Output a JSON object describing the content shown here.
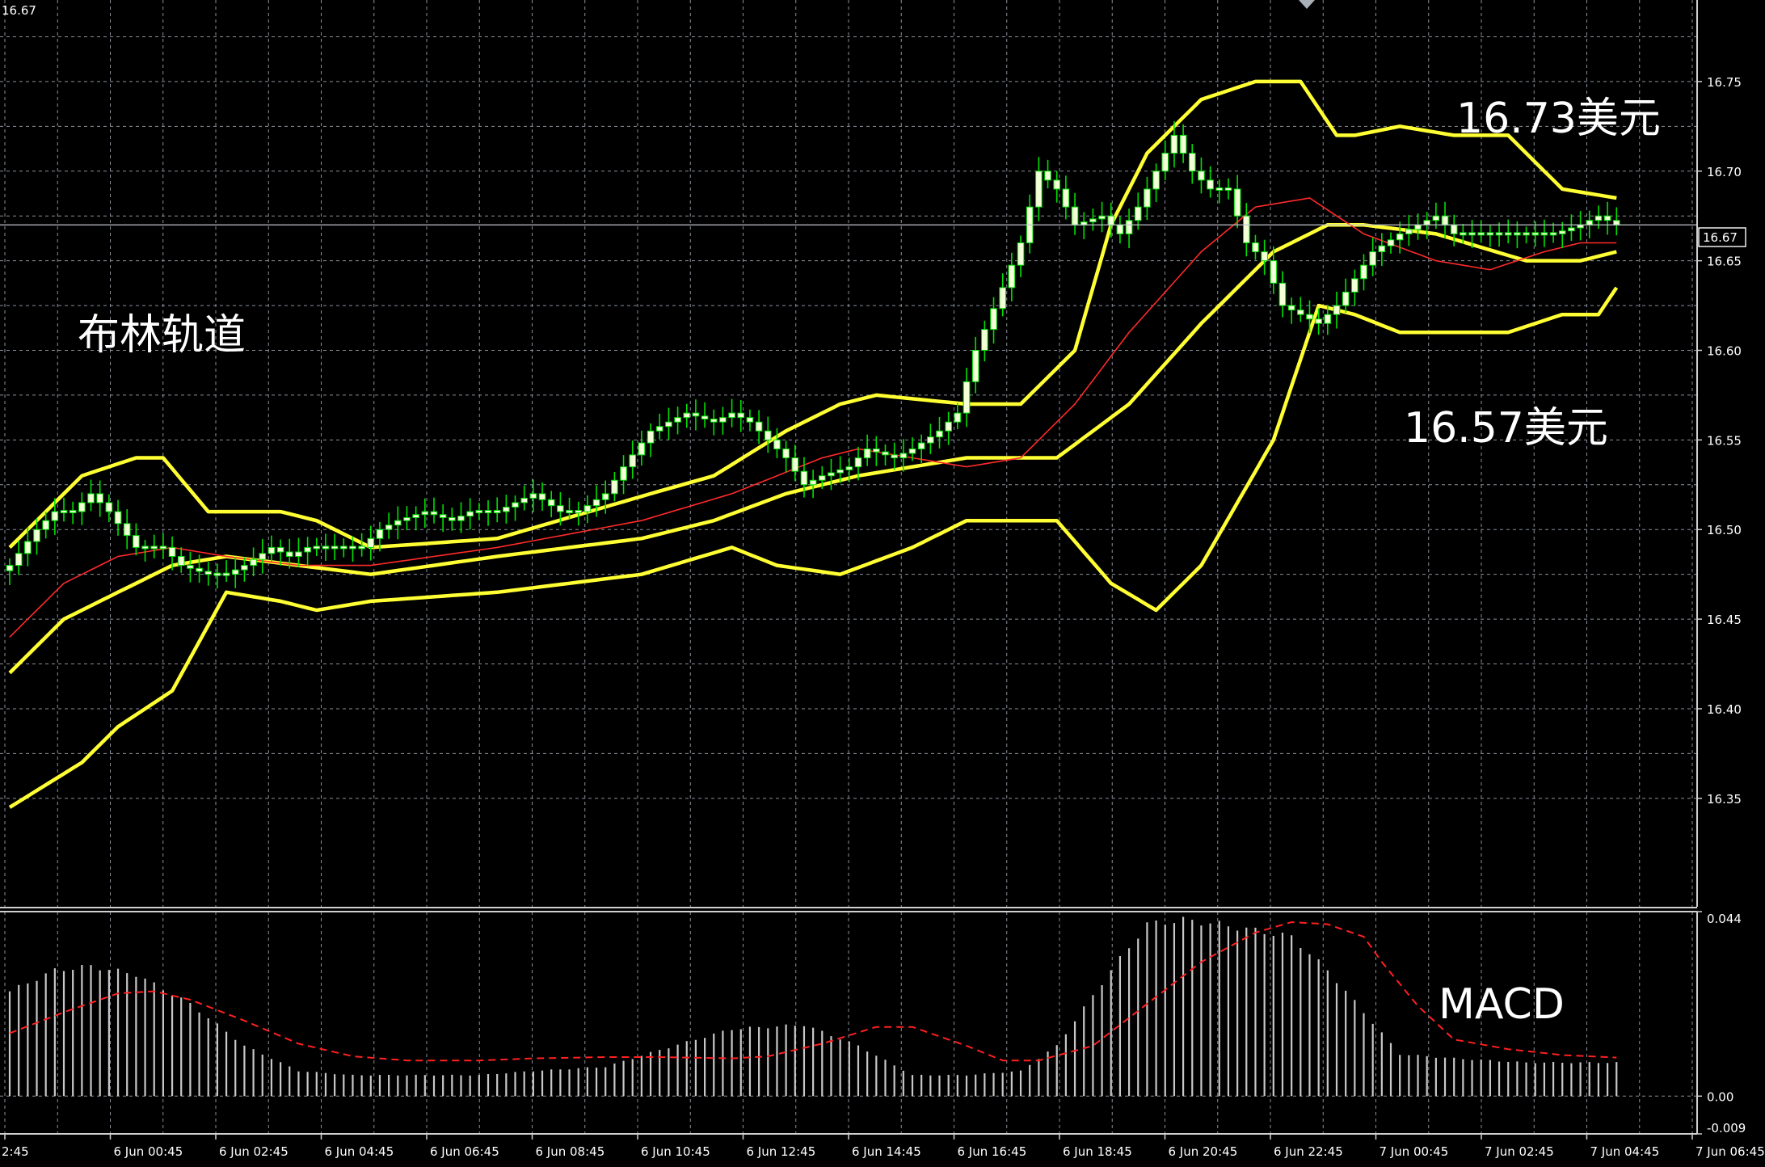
{
  "corner_price": "16.67",
  "current_price_label": "16.67",
  "annotations": {
    "bollinger": "布林轨道",
    "upper_price": "16.73美元",
    "lower_price": "16.57美元",
    "macd": "MACD"
  },
  "colors": {
    "background": "#000000",
    "grid": "#8a9099",
    "candle_body": "#f4ffd8",
    "candle_wick": "#00e000",
    "bollinger": "#ffff33",
    "ma_red": "#ff2a2a",
    "macd_histogram": "#c8c8c8",
    "macd_signal": "#ff2020",
    "text": "#ffffff"
  },
  "chart_data": [
    {
      "type": "candlestick",
      "indicator": "Bollinger Bands",
      "price_ticks": [
        "16.75",
        "16.70",
        "16.65",
        "16.60",
        "16.55",
        "16.50",
        "16.45",
        "16.40",
        "16.35"
      ],
      "ylim": [
        16.2895,
        16.7955
      ],
      "time_labels": [
        "2:45",
        "6 Jun 00:45",
        "6 Jun 02:45",
        "6 Jun 04:45",
        "6 Jun 06:45",
        "6 Jun 08:45",
        "6 Jun 10:45",
        "6 Jun 12:45",
        "6 Jun 14:45",
        "6 Jun 16:45",
        "6 Jun 18:45",
        "6 Jun 20:45",
        "6 Jun 22:45",
        "7 Jun 00:45",
        "7 Jun 02:45",
        "7 Jun 04:45",
        "7 Jun 06:45"
      ],
      "current_price": 16.67,
      "close_anchors": [
        [
          0,
          16.48
        ],
        [
          3,
          16.5
        ],
        [
          5,
          16.51
        ],
        [
          7,
          16.51
        ],
        [
          9,
          16.52
        ],
        [
          11,
          16.51
        ],
        [
          14,
          16.49
        ],
        [
          17,
          16.49
        ],
        [
          19,
          16.48
        ],
        [
          22,
          16.475
        ],
        [
          24,
          16.475
        ],
        [
          26,
          16.48
        ],
        [
          29,
          16.49
        ],
        [
          31,
          16.485
        ],
        [
          33,
          16.49
        ],
        [
          36,
          16.49
        ],
        [
          39,
          16.49
        ],
        [
          41,
          16.5
        ],
        [
          43,
          16.505
        ],
        [
          46,
          16.51
        ],
        [
          49,
          16.505
        ],
        [
          51,
          16.51
        ],
        [
          54,
          16.51
        ],
        [
          56,
          16.515
        ],
        [
          58,
          16.52
        ],
        [
          61,
          16.51
        ],
        [
          63,
          16.51
        ],
        [
          66,
          16.52
        ],
        [
          68,
          16.535
        ],
        [
          71,
          16.555
        ],
        [
          73,
          16.56
        ],
        [
          75,
          16.565
        ],
        [
          78,
          16.56
        ],
        [
          80,
          16.565
        ],
        [
          82,
          16.56
        ],
        [
          84,
          16.55
        ],
        [
          86,
          16.54
        ],
        [
          88,
          16.525
        ],
        [
          90,
          16.53
        ],
        [
          93,
          16.535
        ],
        [
          95,
          16.545
        ],
        [
          98,
          16.54
        ],
        [
          100,
          16.545
        ],
        [
          103,
          16.555
        ],
        [
          105,
          16.565
        ],
        [
          107,
          16.6
        ],
        [
          110,
          16.635
        ],
        [
          112,
          16.66
        ],
        [
          114,
          16.7
        ],
        [
          116,
          16.69
        ],
        [
          118,
          16.67
        ],
        [
          121,
          16.675
        ],
        [
          123,
          16.665
        ],
        [
          125,
          16.68
        ],
        [
          127,
          16.7
        ],
        [
          129,
          16.72
        ],
        [
          131,
          16.7
        ],
        [
          133,
          16.69
        ],
        [
          135,
          16.69
        ],
        [
          137,
          16.66
        ],
        [
          139,
          16.65
        ],
        [
          141,
          16.625
        ],
        [
          143,
          16.62
        ],
        [
          145,
          16.615
        ],
        [
          147,
          16.625
        ],
        [
          149,
          16.64
        ],
        [
          151,
          16.655
        ],
        [
          154,
          16.665
        ],
        [
          156,
          16.67
        ],
        [
          158,
          16.675
        ],
        [
          160,
          16.665
        ],
        [
          163,
          16.665
        ],
        [
          165,
          16.665
        ],
        [
          168,
          16.665
        ],
        [
          171,
          16.665
        ],
        [
          174,
          16.67
        ],
        [
          176,
          16.675
        ],
        [
          178,
          16.67
        ]
      ],
      "bollinger_upper": [
        [
          0,
          16.49
        ],
        [
          8,
          16.53
        ],
        [
          14,
          16.54
        ],
        [
          17,
          16.54
        ],
        [
          22,
          16.51
        ],
        [
          30,
          16.51
        ],
        [
          34,
          16.505
        ],
        [
          40,
          16.49
        ],
        [
          54,
          16.495
        ],
        [
          71,
          16.52
        ],
        [
          78,
          16.53
        ],
        [
          86,
          16.555
        ],
        [
          92,
          16.57
        ],
        [
          96,
          16.575
        ],
        [
          106,
          16.57
        ],
        [
          112,
          16.57
        ],
        [
          118,
          16.6
        ],
        [
          122,
          16.67
        ],
        [
          126,
          16.71
        ],
        [
          132,
          16.74
        ],
        [
          138,
          16.75
        ],
        [
          143,
          16.75
        ],
        [
          147,
          16.72
        ],
        [
          149,
          16.72
        ],
        [
          154,
          16.725
        ],
        [
          160,
          16.72
        ],
        [
          166,
          16.72
        ],
        [
          172,
          16.69
        ],
        [
          178,
          16.685
        ]
      ],
      "bollinger_middle": [
        [
          0,
          16.42
        ],
        [
          6,
          16.45
        ],
        [
          12,
          16.465
        ],
        [
          18,
          16.48
        ],
        [
          24,
          16.485
        ],
        [
          32,
          16.48
        ],
        [
          40,
          16.475
        ],
        [
          54,
          16.485
        ],
        [
          70,
          16.495
        ],
        [
          78,
          16.505
        ],
        [
          86,
          16.52
        ],
        [
          94,
          16.53
        ],
        [
          106,
          16.54
        ],
        [
          116,
          16.54
        ],
        [
          124,
          16.57
        ],
        [
          132,
          16.615
        ],
        [
          140,
          16.655
        ],
        [
          146,
          16.67
        ],
        [
          150,
          16.67
        ],
        [
          158,
          16.665
        ],
        [
          168,
          16.65
        ],
        [
          174,
          16.65
        ],
        [
          178,
          16.655
        ]
      ],
      "bollinger_lower": [
        [
          0,
          16.345
        ],
        [
          8,
          16.37
        ],
        [
          12,
          16.39
        ],
        [
          18,
          16.41
        ],
        [
          24,
          16.465
        ],
        [
          30,
          16.46
        ],
        [
          34,
          16.455
        ],
        [
          40,
          16.46
        ],
        [
          54,
          16.465
        ],
        [
          70,
          16.475
        ],
        [
          80,
          16.49
        ],
        [
          85,
          16.48
        ],
        [
          92,
          16.475
        ],
        [
          100,
          16.49
        ],
        [
          106,
          16.505
        ],
        [
          116,
          16.505
        ],
        [
          122,
          16.47
        ],
        [
          127,
          16.455
        ],
        [
          132,
          16.48
        ],
        [
          140,
          16.55
        ],
        [
          145,
          16.625
        ],
        [
          149,
          16.62
        ],
        [
          154,
          16.61
        ],
        [
          166,
          16.61
        ],
        [
          172,
          16.62
        ],
        [
          176,
          16.62
        ],
        [
          178,
          16.635
        ]
      ],
      "moving_average": [
        [
          0,
          16.44
        ],
        [
          6,
          16.47
        ],
        [
          12,
          16.485
        ],
        [
          18,
          16.49
        ],
        [
          24,
          16.485
        ],
        [
          32,
          16.48
        ],
        [
          40,
          16.48
        ],
        [
          54,
          16.49
        ],
        [
          70,
          16.505
        ],
        [
          80,
          16.52
        ],
        [
          90,
          16.54
        ],
        [
          94,
          16.545
        ],
        [
          106,
          16.535
        ],
        [
          112,
          16.54
        ],
        [
          118,
          16.57
        ],
        [
          124,
          16.61
        ],
        [
          132,
          16.655
        ],
        [
          138,
          16.68
        ],
        [
          144,
          16.685
        ],
        [
          150,
          16.665
        ],
        [
          158,
          16.65
        ],
        [
          164,
          16.645
        ],
        [
          170,
          16.655
        ],
        [
          174,
          16.66
        ],
        [
          178,
          16.66
        ]
      ]
    },
    {
      "type": "histogram",
      "indicator": "MACD",
      "value_ticks": [
        "0.044",
        "0.00",
        "-0.009"
      ],
      "ylim": [
        -0.009,
        0.044
      ],
      "histogram_anchors": [
        [
          0,
          0.025
        ],
        [
          5,
          0.03
        ],
        [
          9,
          0.031
        ],
        [
          14,
          0.029
        ],
        [
          20,
          0.022
        ],
        [
          26,
          0.012
        ],
        [
          32,
          0.006
        ],
        [
          38,
          0.005
        ],
        [
          44,
          0.005
        ],
        [
          52,
          0.005
        ],
        [
          58,
          0.006
        ],
        [
          66,
          0.007
        ],
        [
          72,
          0.011
        ],
        [
          80,
          0.016
        ],
        [
          88,
          0.017
        ],
        [
          94,
          0.012
        ],
        [
          100,
          0.005
        ],
        [
          106,
          0.005
        ],
        [
          112,
          0.006
        ],
        [
          116,
          0.012
        ],
        [
          122,
          0.03
        ],
        [
          126,
          0.041
        ],
        [
          130,
          0.042
        ],
        [
          134,
          0.041
        ],
        [
          142,
          0.038
        ],
        [
          146,
          0.03
        ],
        [
          150,
          0.02
        ],
        [
          154,
          0.01
        ],
        [
          160,
          0.009
        ],
        [
          168,
          0.008
        ],
        [
          174,
          0.008
        ],
        [
          178,
          0.008
        ]
      ],
      "signal_anchors": [
        [
          0,
          0.015
        ],
        [
          6,
          0.02
        ],
        [
          12,
          0.0245
        ],
        [
          16,
          0.025
        ],
        [
          20,
          0.023
        ],
        [
          26,
          0.018
        ],
        [
          32,
          0.0125
        ],
        [
          38,
          0.0095
        ],
        [
          44,
          0.0085
        ],
        [
          52,
          0.0085
        ],
        [
          58,
          0.009
        ],
        [
          66,
          0.0093
        ],
        [
          72,
          0.0093
        ],
        [
          80,
          0.009
        ],
        [
          84,
          0.0095
        ],
        [
          90,
          0.0125
        ],
        [
          96,
          0.0165
        ],
        [
          100,
          0.0165
        ],
        [
          106,
          0.012
        ],
        [
          110,
          0.0085
        ],
        [
          114,
          0.0085
        ],
        [
          120,
          0.012
        ],
        [
          126,
          0.022
        ],
        [
          132,
          0.032
        ],
        [
          138,
          0.039
        ],
        [
          142,
          0.0415
        ],
        [
          146,
          0.041
        ],
        [
          150,
          0.038
        ],
        [
          152,
          0.032
        ],
        [
          156,
          0.0215
        ],
        [
          160,
          0.0135
        ],
        [
          166,
          0.0112
        ],
        [
          172,
          0.0098
        ],
        [
          178,
          0.0092
        ]
      ]
    }
  ]
}
